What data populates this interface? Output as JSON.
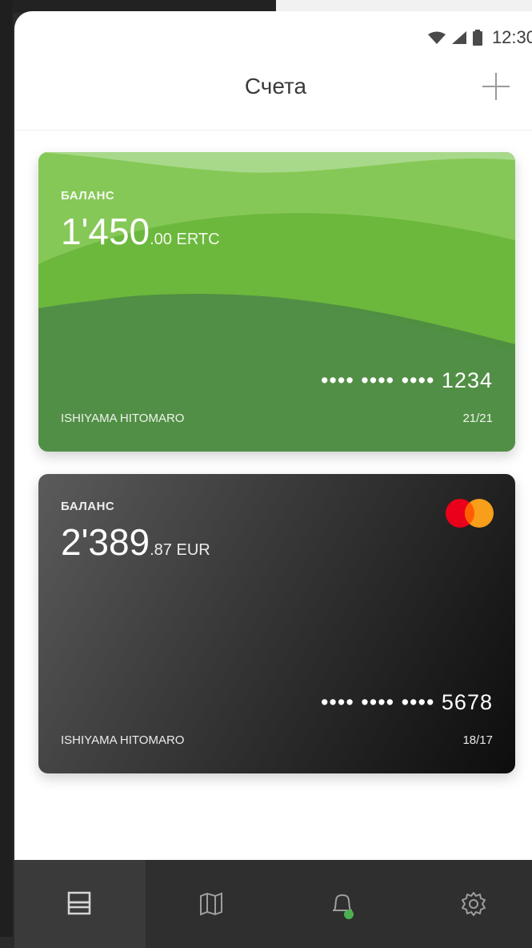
{
  "status_bar": {
    "time": "12:30"
  },
  "header": {
    "title": "Счета",
    "add_icon": "plus-icon"
  },
  "cards": [
    {
      "balance_label": "БАЛАНС",
      "amount_int": "1'450",
      "amount_dec_currency": ".00 ERTC",
      "number": "•••• •••• •••• 1234",
      "holder": "ISHIYAMA HITOMARO",
      "expiry": "21/21",
      "color": "#5fae3c"
    },
    {
      "balance_label": "БАЛАНС",
      "amount_int": "2'389",
      "amount_dec_currency": ".87 EUR",
      "number": "•••• •••• •••• 5678",
      "holder": "ISHIYAMA HITOMARO",
      "expiry": "18/17",
      "brand_icon": "mastercard-icon",
      "color": "#1b1b1b"
    }
  ],
  "bottom_nav": {
    "items": [
      {
        "icon": "cards-icon",
        "active": true
      },
      {
        "icon": "map-icon",
        "active": false
      },
      {
        "icon": "bell-icon",
        "active": false,
        "badge_color": "#4caf50"
      },
      {
        "icon": "gear-icon",
        "active": false
      }
    ]
  }
}
